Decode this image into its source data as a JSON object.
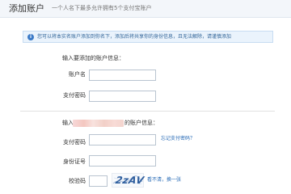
{
  "header": {
    "title": "添加账户",
    "subtitle": "一个人名下最多允许拥有5个支付宝账户"
  },
  "notice": {
    "icon": "info-icon",
    "text": "您可以将本实名账户添加到你名下，添加后将共享你的身份信息，且无法解除，请谨慎添加"
  },
  "add_section": {
    "heading": "输入要添加的账户信息：",
    "account_label": "账户名",
    "account_value": "",
    "password_label": "支付密码",
    "password_value": ""
  },
  "current_section": {
    "heading_prefix": "输入",
    "heading_suffix": "的账户信息：",
    "password_label": "支付密码",
    "password_value": "",
    "forgot_link": "忘记支付密码？",
    "id_label": "身份证号",
    "id_value": "",
    "captcha_label": "校验码",
    "captcha_value": "",
    "captcha_image_text": "2zAV",
    "refresh_link": "看不清，换一张"
  },
  "colors": {
    "link": "#2468b5",
    "notice_bg": "#eaf3fc",
    "notice_border": "#c7dcf2",
    "info_icon": "#3b7ac7"
  }
}
